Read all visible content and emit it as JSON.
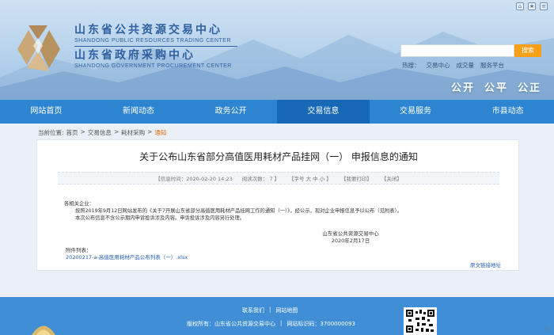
{
  "header": {
    "org_cn_1": "山东省公共资源交易中心",
    "org_en_1": "SHANDONG PUBLIC RESOURCES TRADING CENTER",
    "org_cn_2": "山东省政府采购中心",
    "org_en_2": "SHANDONG GOVERNMENT PROCUREMENT CENTER",
    "top_icons": [
      "home-icon",
      "star-icon",
      "menu-icon"
    ],
    "search_placeholder": "",
    "search_button": "搜索",
    "hot_label": "热搜：",
    "hot_links": [
      "交易中心",
      "成交量",
      "服务平台"
    ],
    "slogan": [
      "公开",
      "公平",
      "公正"
    ]
  },
  "nav": {
    "items": [
      "网站首页",
      "新闻动态",
      "政务公开",
      "交易信息",
      "交易服务",
      "市县动态"
    ],
    "active_index": 3
  },
  "breadcrumb": {
    "label": "当前位置:",
    "items": [
      "首页",
      "交易信息",
      "耗材采购"
    ],
    "separator": ">",
    "current": "通知"
  },
  "article": {
    "title": "关于公布山东省部分高值医用耗材产品挂网（一） 申报信息的通知",
    "info": {
      "date": "【信息时间：2020-02-20 14:23",
      "views": "阅读次数：  7  】",
      "font_size": "【字号 大 中 小 】",
      "print": "【我要打印】",
      "close": "【关闭】"
    },
    "body": [
      "各相关企业：",
      "按照2019年9月12日网站发布的《关于7开展山东省部分高值医用耗材产品挂网工作的通知（一）》，经公示，现对企业申报信息予以公布（见附表）。",
      "本次公布信息不含公示期内申诉投诉涉及内容。申诉投诉涉及内容另行处理。"
    ],
    "signature_org": "山东省公共资源交易中心",
    "signature_date": "2020年2月17日",
    "attachment_label": "附件列表：",
    "attachment_link": "20200217-a-高值医用耗材产品公布列表（一）.xlsx",
    "original_link": "原文链接地址"
  },
  "footer": {
    "links": [
      "联系我们",
      "|",
      "网站地图"
    ],
    "copyright": "版权所有：山东省公共资源交易中心",
    "separator": "|",
    "site_code": "网站标识码：3700000093"
  },
  "colors": {
    "nav_bg": "#2d84d0",
    "nav_active": "#1768b5",
    "search_button": "#f6a01a",
    "link": "#2461b3",
    "crumb_current": "#e36c0a",
    "footer_bg": "#3f8ed6"
  }
}
